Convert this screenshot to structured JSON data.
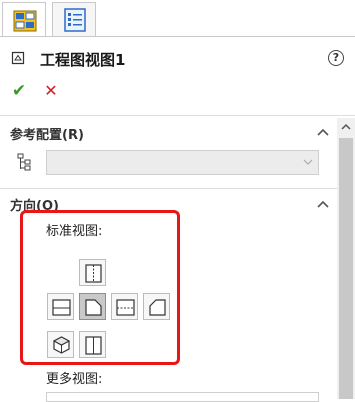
{
  "tabs": [
    {
      "name": "property-manager-tab"
    },
    {
      "name": "feature-tree-tab"
    }
  ],
  "title": {
    "text": "工程图视图1",
    "help": "?"
  },
  "actions": {
    "ok_glyph": "✔",
    "cancel_glyph": "✕"
  },
  "sections": {
    "reference_config": {
      "title": "参考配置(R)",
      "value": ""
    },
    "orientation": {
      "title": "方向(O)",
      "standard_views_label": "标准视图:",
      "more_views_label": "更多视图:",
      "selected_view": "front"
    }
  },
  "colors": {
    "highlight_box": "#e81717",
    "ok": "#3a9a26",
    "cancel": "#d21d1d"
  }
}
